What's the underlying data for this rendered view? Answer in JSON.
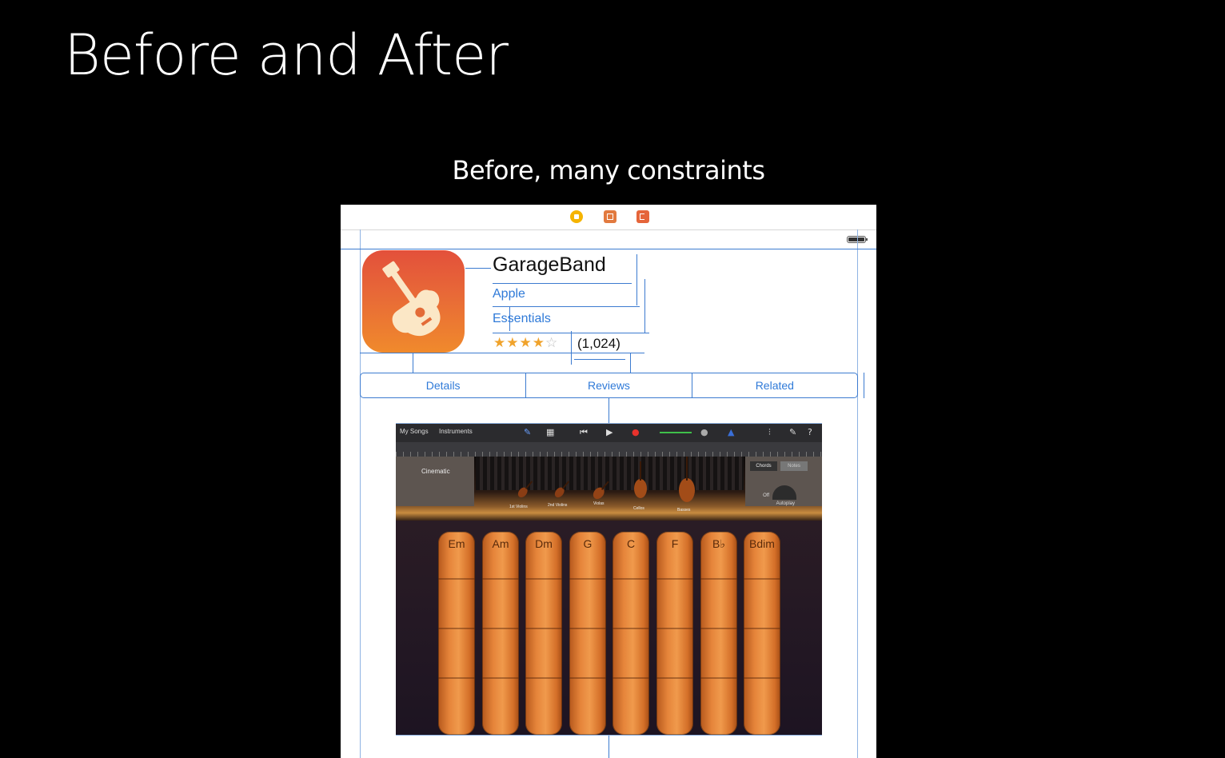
{
  "slide": {
    "title": "Before and After",
    "subtitle": "Before, many constraints"
  },
  "scene_dock": {
    "icons": [
      "view-controller-icon",
      "first-responder-icon",
      "exit-icon"
    ],
    "colors": {
      "view_controller": "#f5b400",
      "first_responder": "#e27a3f",
      "exit": "#e5653a"
    }
  },
  "app": {
    "name": "GarageBand",
    "developer": "Apple",
    "category": "Essentials",
    "rating_stars": 4,
    "rating_max": 5,
    "rating_count": "(1,024)"
  },
  "tabs": [
    {
      "label": "Details"
    },
    {
      "label": "Reviews"
    },
    {
      "label": "Related"
    }
  ],
  "garageband": {
    "toolbar": {
      "my_songs": "My Songs",
      "instruments": "Instruments"
    },
    "left_panel": "Cinematic",
    "right_panel": {
      "chords": "Chords",
      "notes": "Notes",
      "off": "Off",
      "autoplay": "Autoplay"
    },
    "instruments": [
      "1st Violins",
      "2nd Violins",
      "Violas",
      "Cellos",
      "Basses"
    ],
    "chords": [
      "Em",
      "Am",
      "Dm",
      "G",
      "C",
      "F",
      "B♭",
      "Bdim"
    ]
  },
  "colors": {
    "background": "#000000",
    "canvas": "#ffffff",
    "constraint": "#3c7bd0",
    "link_text": "#2f7ad8",
    "star": "#f0a32c"
  }
}
